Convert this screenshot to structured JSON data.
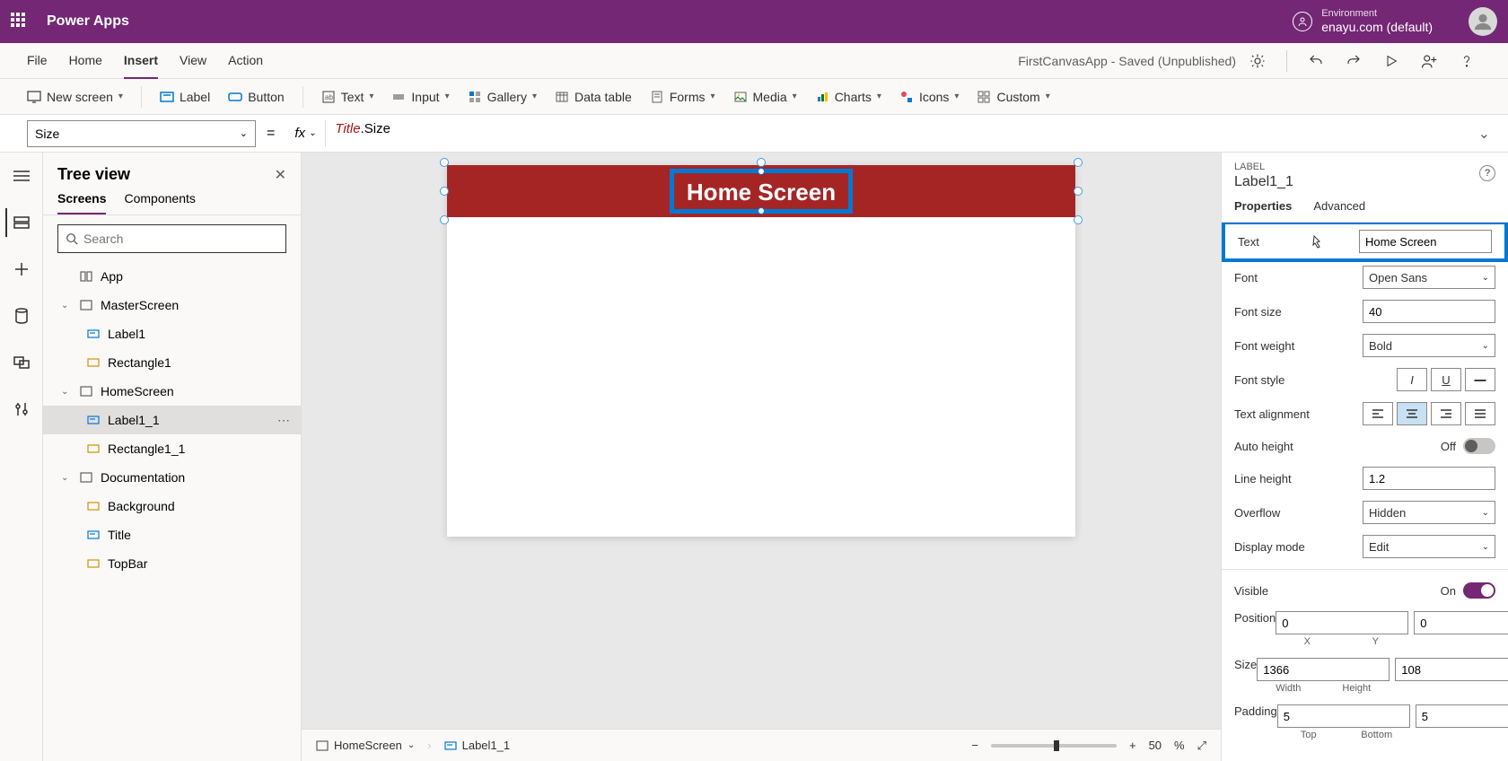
{
  "header": {
    "app_name": "Power Apps",
    "env_label": "Environment",
    "env_value": "enayu.com (default)"
  },
  "ribbon": {
    "tabs": [
      "File",
      "Home",
      "Insert",
      "View",
      "Action"
    ],
    "active_tab": "Insert",
    "doc_title": "FirstCanvasApp - Saved (Unpublished)"
  },
  "toolbar": {
    "new_screen": "New screen",
    "label": "Label",
    "button": "Button",
    "text": "Text",
    "input": "Input",
    "gallery": "Gallery",
    "data_table": "Data table",
    "forms": "Forms",
    "media": "Media",
    "charts": "Charts",
    "icons": "Icons",
    "custom": "Custom"
  },
  "formula": {
    "property": "Size",
    "fx": "fx",
    "expr_obj": "Title",
    "expr_rest": ".Size"
  },
  "tree": {
    "title": "Tree view",
    "tabs": [
      "Screens",
      "Components"
    ],
    "search_placeholder": "Search",
    "items": [
      {
        "label": "App",
        "icon": "app",
        "depth": 1
      },
      {
        "label": "MasterScreen",
        "icon": "screen",
        "depth": 1,
        "expand": true
      },
      {
        "label": "Label1",
        "icon": "label",
        "depth": 2
      },
      {
        "label": "Rectangle1",
        "icon": "rect",
        "depth": 2
      },
      {
        "label": "HomeScreen",
        "icon": "screen",
        "depth": 1,
        "expand": true
      },
      {
        "label": "Label1_1",
        "icon": "label",
        "depth": 2,
        "selected": true
      },
      {
        "label": "Rectangle1_1",
        "icon": "rect",
        "depth": 2
      },
      {
        "label": "Documentation",
        "icon": "screen",
        "depth": 1,
        "expand": true
      },
      {
        "label": "Background",
        "icon": "rect",
        "depth": 2
      },
      {
        "label": "Title",
        "icon": "label",
        "depth": 2
      },
      {
        "label": "TopBar",
        "icon": "rect",
        "depth": 2
      }
    ]
  },
  "canvas": {
    "label_text": "Home Screen"
  },
  "status": {
    "screen_name": "HomeScreen",
    "selected": "Label1_1",
    "zoom": "50",
    "zoom_unit": "%"
  },
  "props": {
    "type_label": "LABEL",
    "name": "Label1_1",
    "tabs": [
      "Properties",
      "Advanced"
    ],
    "text_label": "Text",
    "text_value": "Home Screen",
    "font_label": "Font",
    "font_value": "Open Sans",
    "fontsize_label": "Font size",
    "fontsize_value": "40",
    "fontweight_label": "Font weight",
    "fontweight_value": "Bold",
    "fontstyle_label": "Font style",
    "textalign_label": "Text alignment",
    "autoheight_label": "Auto height",
    "autoheight_value": "Off",
    "lineheight_label": "Line height",
    "lineheight_value": "1.2",
    "overflow_label": "Overflow",
    "overflow_value": "Hidden",
    "displaymode_label": "Display mode",
    "displaymode_value": "Edit",
    "visible_label": "Visible",
    "visible_value": "On",
    "position_label": "Position",
    "position_x": "0",
    "position_y": "0",
    "position_xl": "X",
    "position_yl": "Y",
    "size_label": "Size",
    "size_w": "1366",
    "size_h": "108",
    "size_wl": "Width",
    "size_hl": "Height",
    "padding_label": "Padding",
    "padding_t": "5",
    "padding_b": "5",
    "padding_tl": "Top",
    "padding_bl": "Bottom"
  }
}
